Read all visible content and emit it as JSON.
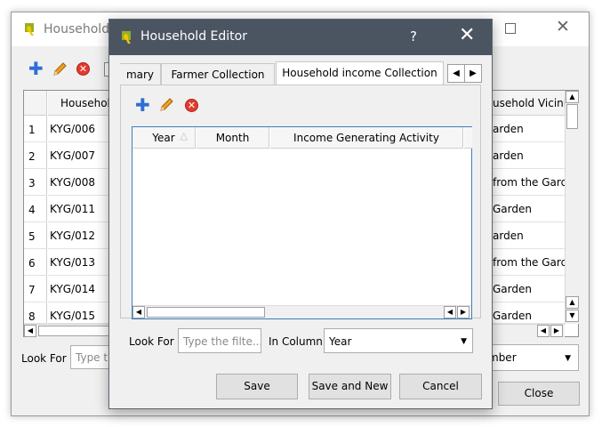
{
  "main_window": {
    "title": "Household",
    "table": {
      "col_left_header": "Househol",
      "col_right_header": "usehold Vicinit",
      "row_numbers": [
        "1",
        "2",
        "3",
        "4",
        "5",
        "6",
        "7",
        "8"
      ],
      "left_values": [
        "KYG/006",
        "KYG/007",
        "KYG/008",
        "KYG/011",
        "KYG/012",
        "KYG/013",
        "KYG/014",
        "KYG/015"
      ],
      "right_values": [
        "arden",
        "arden",
        " from the Gard",
        "Garden",
        "arden",
        " from the Gard",
        "Garden",
        "Garden"
      ]
    },
    "look_for_label": "Look For",
    "filter_placeholder": "Type th",
    "column_value": "mber",
    "close_label": "Close"
  },
  "dialog": {
    "title": "Household Editor",
    "help_glyph": "?",
    "tabs": [
      "mary",
      "Farmer Collection",
      "Household income Collection"
    ],
    "table_headers": [
      "Year",
      "Month",
      "Income Generating Activity"
    ],
    "look_for_label": "Look For",
    "filter_placeholder": "Type the filte...",
    "in_column_label": "In Column",
    "column_value": "Year",
    "buttons": {
      "save": "Save",
      "save_new": "Save and New",
      "cancel": "Cancel"
    }
  },
  "icons": {
    "app": "qgis-logo-icon",
    "add": "plus-icon",
    "edit": "pencil-icon",
    "delete": "delete-icon"
  },
  "colors": {
    "dialog_titlebar": "#4b5562",
    "table_focus_border": "#3c7fbf",
    "add_icon": "#2d6fd6",
    "delete_icon": "#e23b2e"
  }
}
